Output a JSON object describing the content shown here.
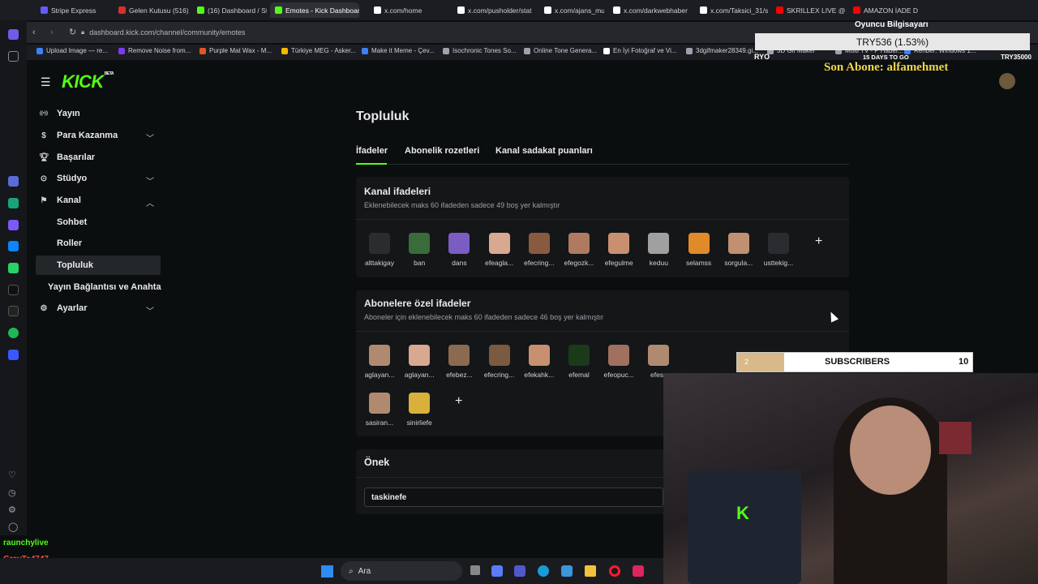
{
  "browser": {
    "tabs": [
      {
        "title": "Stripe Express",
        "color": "#635bff"
      },
      {
        "title": "Gelen Kutusu (516) -",
        "color": "#d93025"
      },
      {
        "title": "(16) Dashboard / Stre",
        "color": "#53fc18"
      },
      {
        "title": "Emotes - Kick Dashboard",
        "color": "#53fc18",
        "active": true
      },
      {
        "title": "x.com/home",
        "color": "#ffffff"
      },
      {
        "title": "x.com/pusholder/stat",
        "color": "#ffffff"
      },
      {
        "title": "x.com/ajans_muhbir/",
        "color": "#ffffff"
      },
      {
        "title": "x.com/darkwebhaber",
        "color": "#ffffff"
      },
      {
        "title": "x.com/Taksici_31/stat",
        "color": "#ffffff"
      },
      {
        "title": "SKRILLEX LIVE @ ULTI",
        "color": "#ff0000"
      },
      {
        "title": "AMAZON İADE D",
        "color": "#ff0000"
      }
    ],
    "url": "dashboard.kick.com/channel/community/emotes",
    "bookmarks": [
      "Upload Image — re...",
      "Remove Noise from...",
      "Purple Mat Wax - M...",
      "Türkiye MEG - Asker...",
      "Make it Meme - Çev...",
      "Isochronic Tones So...",
      "Online Tone Genera...",
      "En İyi Fotoğraf ve Vi...",
      "3dgifmaker28349.gi...",
      "3D Gif Maker",
      "Multi TV - P Haber...",
      "Rehber: Windows 1..."
    ]
  },
  "kick": {
    "logo": "KICK",
    "logo_badge": "BETA",
    "nav": [
      {
        "label": "Yayın",
        "icon": "broadcast-icon"
      },
      {
        "label": "Para Kazanma",
        "icon": "dollar-icon",
        "expandable": true
      },
      {
        "label": "Başarılar",
        "icon": "trophy-icon"
      },
      {
        "label": "Stüdyo",
        "icon": "studio-icon",
        "expandable": true
      },
      {
        "label": "Kanal",
        "icon": "channel-icon",
        "expanded": true
      }
    ],
    "kanal_sub": [
      "Sohbet",
      "Roller",
      "Topluluk",
      "Yayın Bağlantısı ve Anahtarı"
    ],
    "settings": "Ayarlar",
    "page_title": "Topluluk",
    "tabs": [
      "İfadeler",
      "Abonelik rozetleri",
      "Kanal sadakat puanları"
    ],
    "channel_emotes": {
      "title": "Kanal ifadeleri",
      "subtitle": "Eklenebilecek maks 60 ifadeden sadece 49 boş yer kalmıştır",
      "items": [
        "alttakigay",
        "ban",
        "dans",
        "efeagla...",
        "efecring...",
        "efegozk...",
        "efegulme",
        "keduu",
        "selamss",
        "sorgula...",
        "usttekig..."
      ]
    },
    "sub_emotes": {
      "title": "Abonelere özel ifadeler",
      "subtitle": "Aboneler için eklenebilecek maks 60 ifadeden sadece 46 boş yer kalmıştır",
      "items": [
        "aglayan...",
        "aglayan...",
        "efebez...",
        "efecring...",
        "efekahk...",
        "efemal",
        "efeopuc...",
        "efesa"
      ],
      "items_row2": [
        "sasiran...",
        "sinirliefe"
      ]
    },
    "prefix": {
      "title": "Önek",
      "value": "taskinefe"
    }
  },
  "overlay": {
    "top_label": "Oyuncu Bilgisayarı",
    "top_value": "TRY536 (1.53%)",
    "goal_left": "RYO",
    "goal_mid": "15 DAYS TO GO",
    "goal_right": "TRY35000",
    "last_sub": "Son Abone: alfamehmet",
    "subs_label": "SUBSCRIBERS",
    "subs_current": "2",
    "subs_goal": "10"
  },
  "chat": [
    {
      "user": "raunchylive",
      "text": ""
    },
    {
      "user": "GreyTe4747",
      "text": ""
    }
  ],
  "taskbar": {
    "search": "Ara"
  }
}
